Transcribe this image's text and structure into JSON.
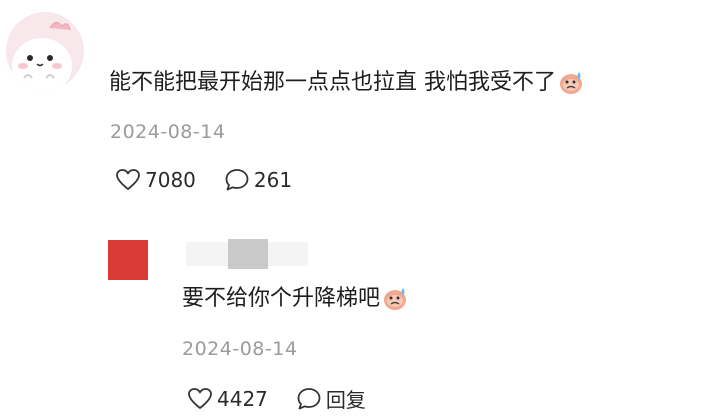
{
  "comment": {
    "text": "能不能把最开始那一点点也拉直 我怕我受不了",
    "date": "2024-08-14",
    "likes": "7080",
    "replies": "261",
    "emoji": "sweat-face-emoji"
  },
  "reply": {
    "text": "要不给你个升降梯吧",
    "date": "2024-08-14",
    "likes": "4427",
    "reply_label": "回复",
    "emoji": "sweat-face-emoji"
  },
  "colors": {
    "avatar_bg": "#f8e8ec",
    "reply_avatar": "#d93a33",
    "muted_text": "#9b9b9b"
  }
}
